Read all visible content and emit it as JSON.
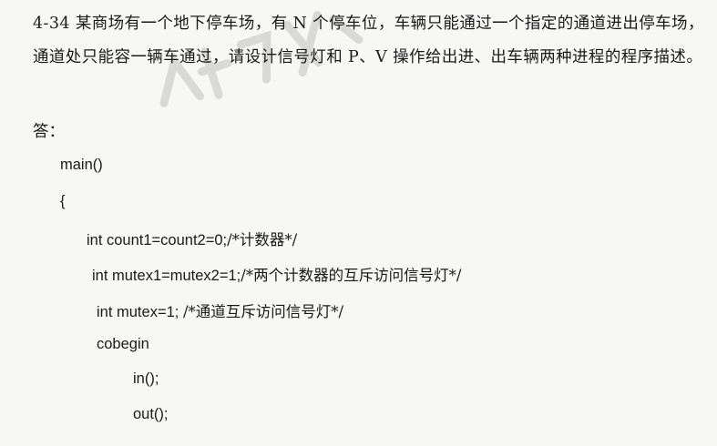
{
  "question": {
    "text": "4-34 某商场有一个地下停车场，有 N 个停车位，车辆只能通过一个指定的通道进出停车场，通道处只能容一辆车通过，请设计信号灯和 P、V 操作给出进、出车辆两种进程的程序描述。"
  },
  "answer_label": "答：",
  "code": {
    "line1": "main()",
    "line2": "{",
    "line3_code": "int count1=count2=0;",
    "line3_comment": "/*计数器*/",
    "line4_code": "int mutex1=mutex2=1;",
    "line4_comment": "/*两个计数器的互斥访问信号灯*/",
    "line5_code": "int mutex=1; ",
    "line5_comment": "/*通道互斥访问信号灯*/",
    "line6": "cobegin",
    "line7": "in();",
    "line8": "out();"
  }
}
